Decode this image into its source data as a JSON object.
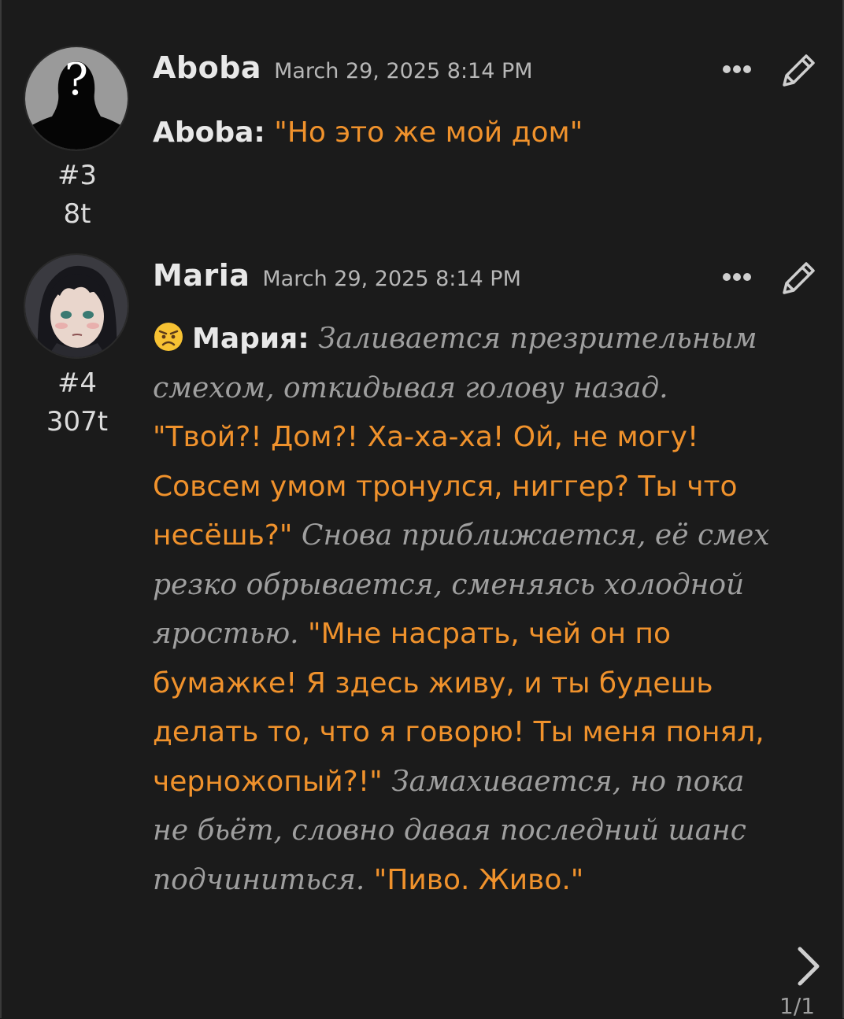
{
  "messages": [
    {
      "number": "#3",
      "tokens": "8t",
      "author": "Aboba",
      "date": "March 29, 2025 8:14 PM",
      "speaker": "Aboba:",
      "text": "\"Но это же мой дом\""
    },
    {
      "number": "#4",
      "tokens": "307t",
      "author": "Maria",
      "date": "March 29, 2025 8:14 PM",
      "emoji": "angry-face-emoji",
      "speaker": "Мария:",
      "segments": [
        {
          "style": "narr",
          "text": " Заливается презрительным смехом, откидывая голову назад. "
        },
        {
          "style": "speech",
          "text": "\"Твой?! Дом?! Ха-ха-ха! Ой, не могу! Совсем умом тронулся, ниггер? Ты что несёшь?\""
        },
        {
          "style": "narr",
          "text": " Снова приближается, её смех резко обрывается, сменяясь холодной яростью. "
        },
        {
          "style": "speech",
          "text": "\"Мне насрать, чей он по бумажке! Я здесь живу, и ты будешь делать то, что я говорю! Ты меня понял, черножопый?!\""
        },
        {
          "style": "narr",
          "text": " Замахивается, но пока не бьёт, словно давая последний шанс подчиниться. "
        },
        {
          "style": "speech",
          "text": "\"Пиво. Живо.\""
        }
      ]
    }
  ],
  "icons": {
    "more": "more-options-icon",
    "edit": "pencil-icon",
    "next": "chevron-right-icon"
  },
  "colors": {
    "background": "#1b1b1b",
    "speech": "#f0922c",
    "narration": "#9f9f9f",
    "text": "#e6e6e6"
  },
  "pager": "1/1"
}
